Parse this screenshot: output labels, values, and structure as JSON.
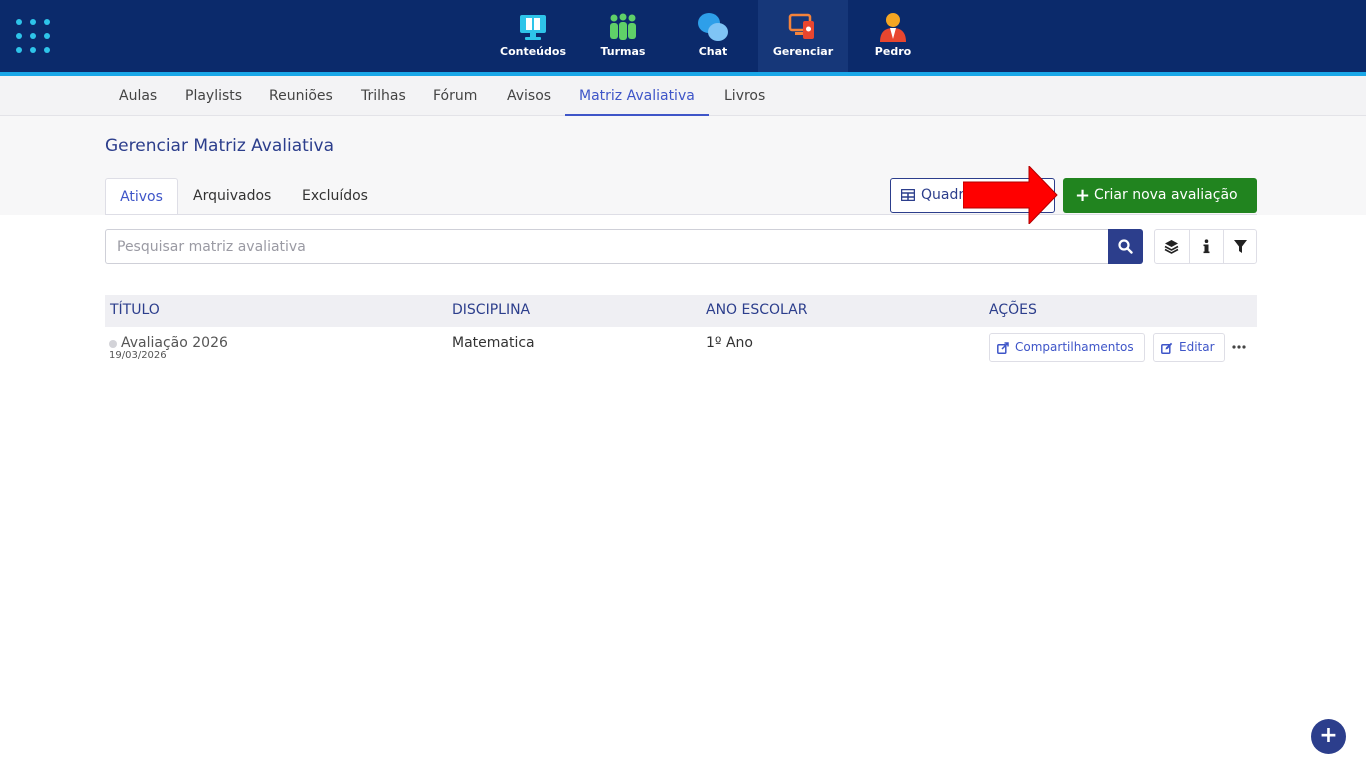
{
  "topnav": {
    "items": [
      {
        "label": "Conteúdos"
      },
      {
        "label": "Turmas"
      },
      {
        "label": "Chat"
      },
      {
        "label": "Gerenciar"
      },
      {
        "label": "Pedro"
      }
    ],
    "active": "Gerenciar"
  },
  "subnav": {
    "items": [
      "Aulas",
      "Playlists",
      "Reuniões",
      "Trilhas",
      "Fórum",
      "Avisos",
      "Matriz Avaliativa",
      "Livros"
    ],
    "active": "Matriz Avaliativa"
  },
  "page": {
    "title": "Gerenciar Matriz Avaliativa",
    "tabs": [
      "Ativos",
      "Arquivados",
      "Excluídos"
    ],
    "active_tab": "Ativos",
    "quadro_label": "Quadro",
    "create_label": "Criar nova avaliação",
    "search_placeholder": "Pesquisar matriz avaliativa"
  },
  "table": {
    "headers": [
      "TÍTULO",
      "DISCIPLINA",
      "ANO ESCOLAR",
      "AÇÕES"
    ],
    "rows": [
      {
        "title": "Avaliação 2026",
        "date": "19/03/2026",
        "discipline": "Matematica",
        "year": "1º Ano",
        "share_label": "Compartilhamentos",
        "edit_label": "Editar"
      }
    ]
  },
  "colors": {
    "topbar": "#0b2a6b",
    "accent": "#3e55c8",
    "primary": "#2c3e8c",
    "success": "#21841f",
    "arrow": "#ff0000"
  },
  "fab_label": "+"
}
